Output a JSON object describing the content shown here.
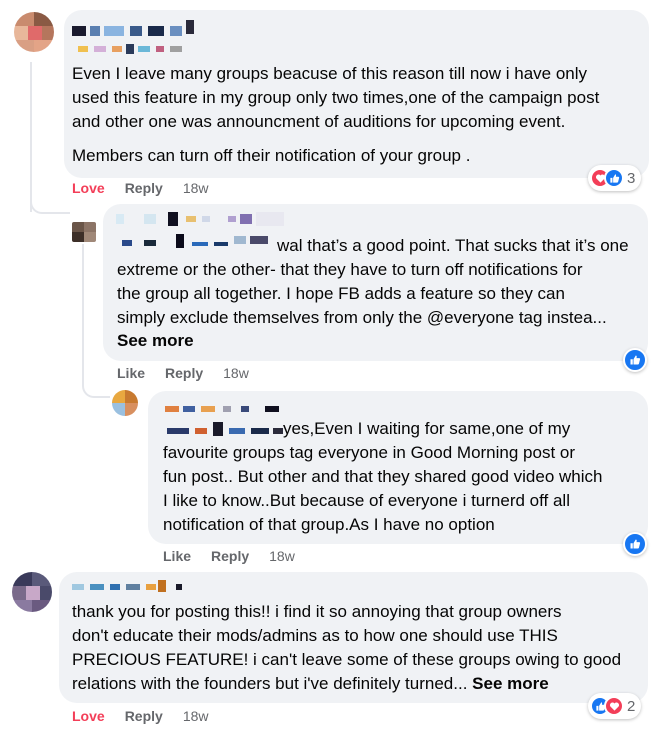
{
  "colors": {
    "bubble_bg": "#f0f2f5",
    "love_red": "#f33e58",
    "like_blue": "#1877f2",
    "muted": "#65676b"
  },
  "comments": [
    {
      "id": "c1",
      "paragraphs": [
        "Even I leave many groups beacuse of this reason till now i have only\nused this feature in my group only two times,one of the campaign post\nand other one was announcment of auditions for upcoming event.",
        "Members can turn off their notification of your group ."
      ],
      "actions": {
        "react": "Love",
        "reply": "Reply",
        "time": "18w"
      },
      "reactions": {
        "icons": [
          "love-icon",
          "like-icon"
        ],
        "count": "3"
      }
    },
    {
      "id": "c2",
      "text": "wal that’s a good point. That sucks that it’s one\nextreme or the other- that they have to turn off notifications for\nthe group all together. I hope FB adds a feature so they can\nsimply exclude themselves from only the @everyone tag instea...",
      "see_more": "See more",
      "actions": {
        "react": "Like",
        "reply": "Reply",
        "time": "18w"
      },
      "reactions": {
        "icons": [
          "like-icon"
        ]
      }
    },
    {
      "id": "c3",
      "text": "yes,Even I waiting for same,one of my\nfavourite groups tag everyone in Good Morning post or\nfun post.. But other and that they shared good video which\nI like to know..But because of everyone i turnerd off all\nnotification of that group.As I have no option",
      "actions": {
        "react": "Like",
        "reply": "Reply",
        "time": "18w"
      },
      "reactions": {
        "icons": [
          "like-icon"
        ]
      }
    },
    {
      "id": "c4",
      "text": "thank you for posting this!! i find it so annoying that group owners\ndon't educate their mods/admins as to how one should use THIS\nPRECIOUS FEATURE! i can't leave some of these groups owing to good\nrelations with the founders but i've definitely turned...",
      "see_more": "See more",
      "actions": {
        "react": "Love",
        "reply": "Reply",
        "time": "18w"
      },
      "reactions": {
        "icons": [
          "like-icon",
          "love-icon"
        ],
        "count": "2"
      }
    }
  ]
}
